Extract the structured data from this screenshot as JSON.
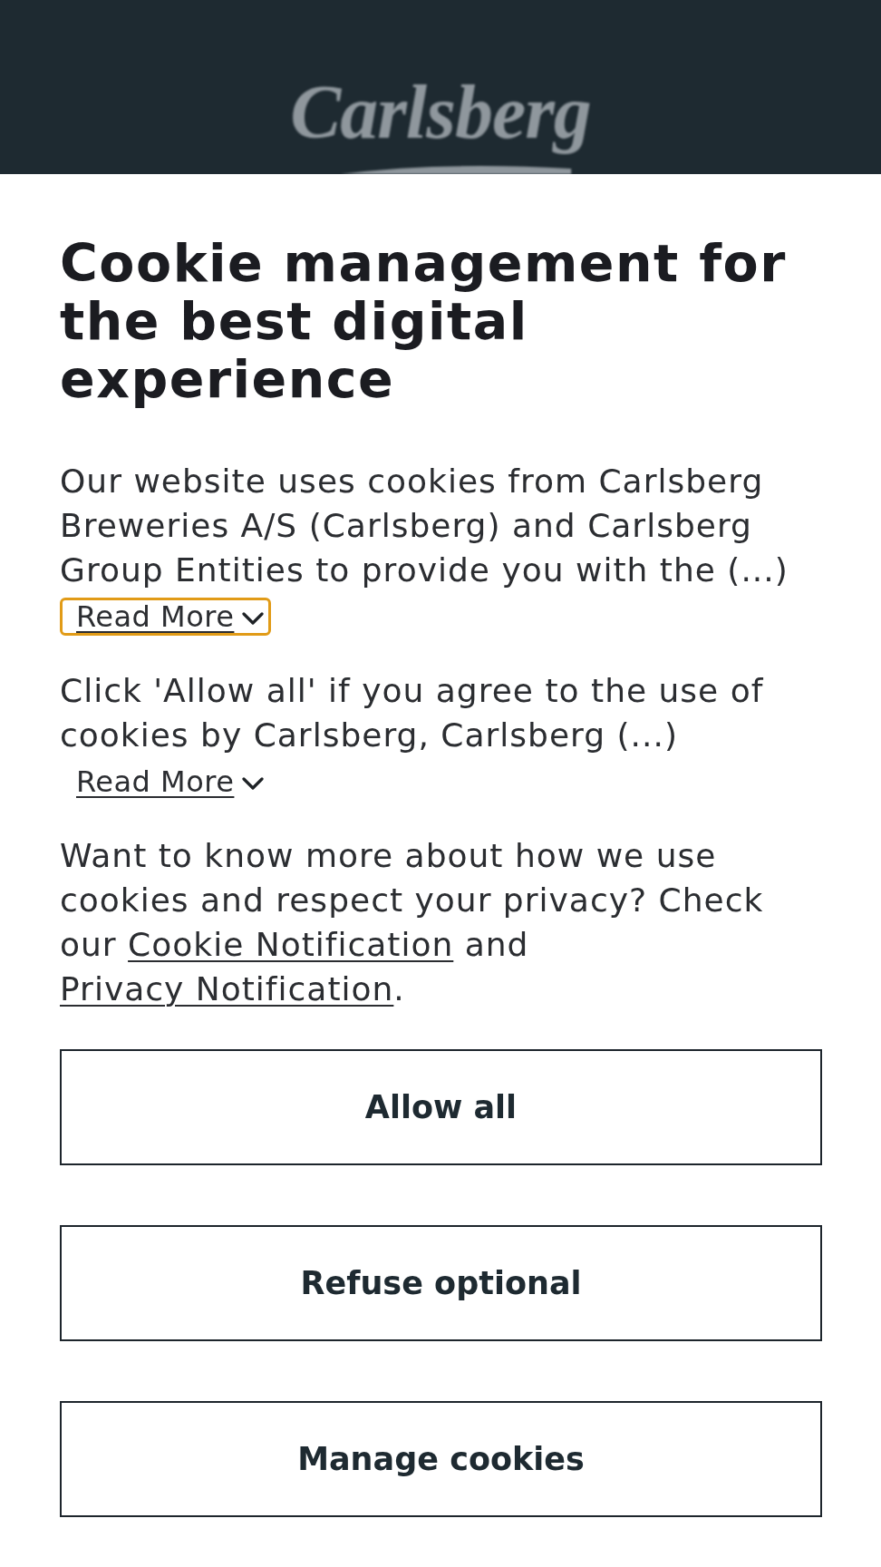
{
  "header": {
    "logo": "Carlsberg"
  },
  "title": "Cookie management for the best digital experience",
  "sections": [
    {
      "text": "Our website uses cookies from Carlsberg Breweries A/S (Carlsberg) and Carlsberg Group Entities to provide you with the (...)",
      "read_more": {
        "label": "Read More",
        "focused": true
      }
    },
    {
      "text": "Click 'Allow all' if you agree to the use of cookies by Carlsberg, Carlsberg (...)",
      "read_more": {
        "label": "Read More",
        "focused": false
      }
    }
  ],
  "notice": [
    {
      "kind": "text",
      "text": "Want to know more about how we use cookies and respect your privacy? Check our "
    },
    {
      "kind": "link",
      "text": "Cookie Notification"
    },
    {
      "kind": "text",
      "text": " and "
    },
    {
      "kind": "link",
      "text": "Privacy Notification"
    },
    {
      "kind": "text",
      "text": "."
    }
  ],
  "buttons": [
    "Allow all",
    "Refuse optional",
    "Manage cookies"
  ]
}
